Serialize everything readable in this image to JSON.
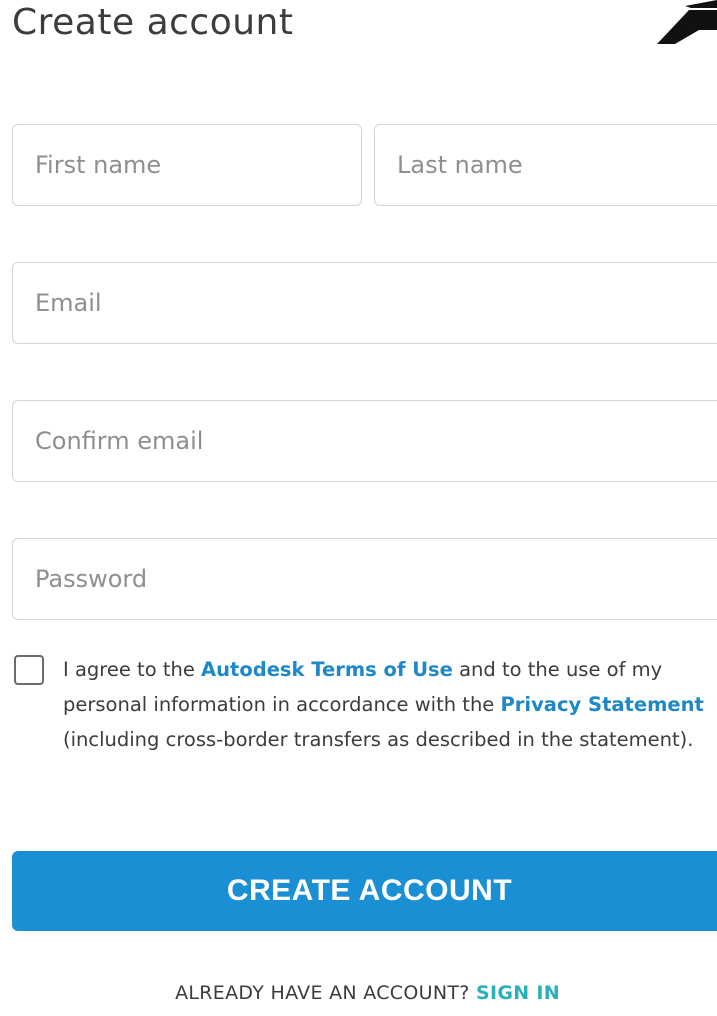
{
  "header": {
    "title": "Create account",
    "logo_icon": "autodesk-logo-icon"
  },
  "form": {
    "first_name_placeholder": "First name",
    "last_name_placeholder": "Last name",
    "email_placeholder": "Email",
    "confirm_email_placeholder": "Confirm email",
    "password_placeholder": "Password",
    "first_name_value": "",
    "last_name_value": "",
    "email_value": "",
    "confirm_email_value": "",
    "password_value": ""
  },
  "agreement": {
    "checked": false,
    "text_1": "I agree to the ",
    "terms_link": "Autodesk Terms of Use",
    "text_2": " and to the use of my personal information in accordance with the ",
    "privacy_link": "Privacy Statement",
    "text_3": " (including cross-border transfers as described in the statement)."
  },
  "actions": {
    "create_account_label": "CREATE ACCOUNT",
    "already_have_account": "ALREADY HAVE AN ACCOUNT? ",
    "sign_in_link": "SIGN IN"
  },
  "colors": {
    "primary_button": "#1a8fd3",
    "link_blue": "#1e88c8",
    "sign_in_teal": "#2ab0b9",
    "border": "#d4d4d4"
  }
}
